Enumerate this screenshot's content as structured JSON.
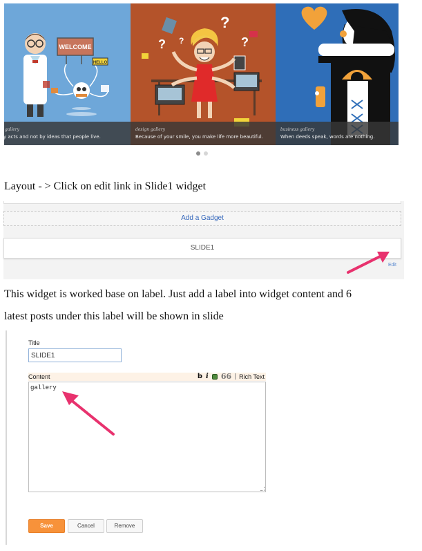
{
  "slider": {
    "slides": [
      {
        "category": "gallery",
        "caption": "y acts and not by ideas that people live.",
        "sign_text": "WELCOME",
        "tag_text": "HELLO"
      },
      {
        "category": "design  gallery",
        "caption": "Because of your smile, you make life more beautiful."
      },
      {
        "category": "business  gallery",
        "caption": "When deeds speak, words are nothing."
      }
    ],
    "active_dot": 0,
    "dot_count": 2
  },
  "instructions": {
    "step1": "Layout - > Click on edit link in Slide1 widget",
    "step2_line1": "This widget is worked base on label. Just add a label into widget content and 6",
    "step2_line2": "latest posts under this label will  be shown in slide"
  },
  "layout_panel": {
    "add_gadget": "Add a Gadget",
    "widget_title": "SLIDE1",
    "edit_link": "Edit"
  },
  "form": {
    "title_label": "Title",
    "title_value": "SLIDE1",
    "content_label": "Content",
    "toolbar": {
      "bold": "b",
      "italic": "i",
      "quote": "66",
      "rich_text": "Rich Text"
    },
    "content_value": "gallery",
    "buttons": {
      "save": "Save",
      "cancel": "Cancel",
      "remove": "Remove"
    }
  },
  "colors": {
    "accent_arrow": "#e8326e",
    "save_button": "#f7923a",
    "link": "#3366bb"
  }
}
